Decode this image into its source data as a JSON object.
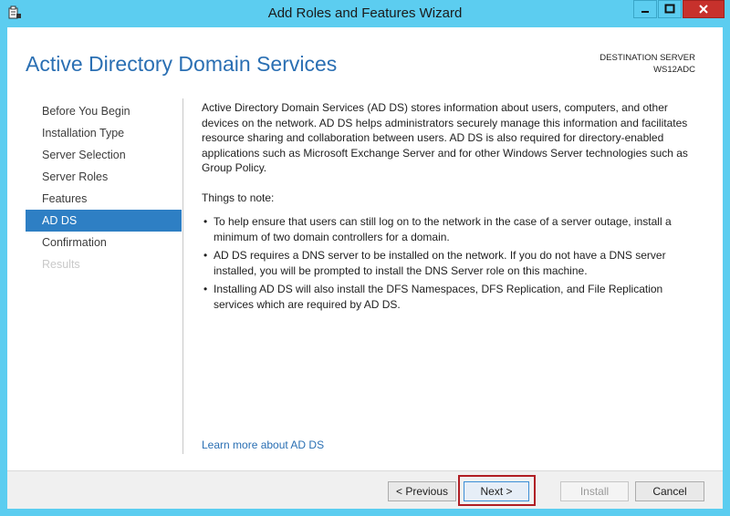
{
  "window": {
    "title": "Add Roles and Features Wizard"
  },
  "header": {
    "page_title": "Active Directory Domain Services",
    "destination_label": "DESTINATION SERVER",
    "destination_server": "WS12ADC"
  },
  "nav": {
    "items": [
      {
        "label": "Before You Begin"
      },
      {
        "label": "Installation Type"
      },
      {
        "label": "Server Selection"
      },
      {
        "label": "Server Roles"
      },
      {
        "label": "Features"
      },
      {
        "label": "AD DS"
      },
      {
        "label": "Confirmation"
      },
      {
        "label": "Results"
      }
    ]
  },
  "content": {
    "intro": "Active Directory Domain Services (AD DS) stores information about users, computers, and other devices on the network.  AD DS helps administrators securely manage this information and facilitates resource sharing and collaboration between users.  AD DS is also required for directory-enabled applications such as Microsoft Exchange Server and for other Windows Server technologies such as Group Policy.",
    "things_to_note": "Things to note:",
    "bullets": [
      "To help ensure that users can still log on to the network in the case of a server outage, install a minimum of two domain controllers for a domain.",
      "AD DS requires a DNS server to be installed on the network.  If you do not have a DNS server installed, you will be prompted to install the DNS Server role on this machine.",
      "Installing AD DS will also install the DFS Namespaces, DFS Replication, and File Replication services which are required by AD DS."
    ],
    "learn_more": "Learn more about AD DS"
  },
  "footer": {
    "previous": "< Previous",
    "next": "Next >",
    "install": "Install",
    "cancel": "Cancel"
  },
  "colors": {
    "titlebar": "#5ccdf0",
    "accent": "#2a6fb3",
    "nav_active": "#2e7fc4",
    "close_button": "#c7312c",
    "highlight_box": "#b01e24"
  },
  "icons": {
    "app": "wizard-icon",
    "minimize": "minimize-icon",
    "maximize": "maximize-icon",
    "close": "close-icon"
  }
}
